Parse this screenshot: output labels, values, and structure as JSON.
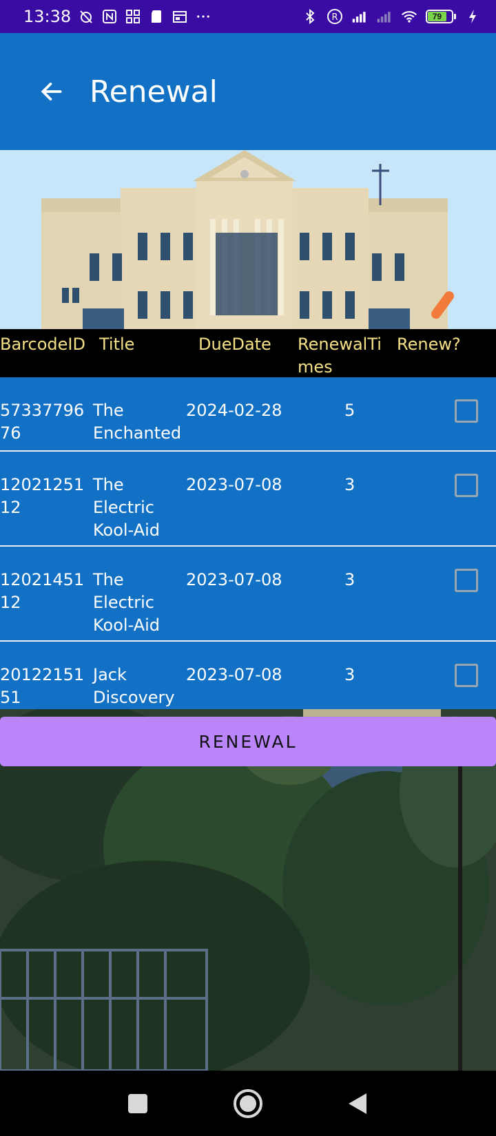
{
  "status_bar": {
    "time": "13:38",
    "battery_level": "79",
    "left_icons": [
      "muted-alarm-icon",
      "nfc-icon",
      "grid-app-icon",
      "sd-card-icon",
      "calendar-icon",
      "more-dots-icon"
    ],
    "right_icons": [
      "bluetooth-icon",
      "registered-icon",
      "signal-icon",
      "signal-no-icon",
      "wifi-icon",
      "battery-icon",
      "charging-icon"
    ]
  },
  "app_bar": {
    "title": "Renewal",
    "back_icon": "arrow-back-icon"
  },
  "table": {
    "headers": {
      "barcode": "BarcodeID",
      "title": "Title",
      "due": "DueDate",
      "times_line1": "RenewalTi",
      "times_line2": "mes",
      "renew": "Renew?"
    },
    "rows": [
      {
        "barcode": "5733779676",
        "title": "The Enchanted",
        "due": "2024-02-28",
        "times": "5",
        "checked": false
      },
      {
        "barcode": "1202125112",
        "title": "The Electric Kool-Aid",
        "due": "2023-07-08",
        "times": "3",
        "checked": false
      },
      {
        "barcode": "1202145112",
        "title": "The Electric Kool-Aid",
        "due": "2023-07-08",
        "times": "3",
        "checked": false
      },
      {
        "barcode": "2012215151",
        "title": "Jack Discovery",
        "due": "2023-07-08",
        "times": "3",
        "checked": false
      }
    ]
  },
  "renew_button": {
    "label": "RENEWAL"
  },
  "colors": {
    "status_bar": "#3a0ca3",
    "app_bar": "#1271c4",
    "header_text": "#f4e085",
    "button": "#bb86fc"
  },
  "nav_bar": {
    "icons": [
      "recents-square-icon",
      "home-circle-icon",
      "back-triangle-icon"
    ]
  }
}
